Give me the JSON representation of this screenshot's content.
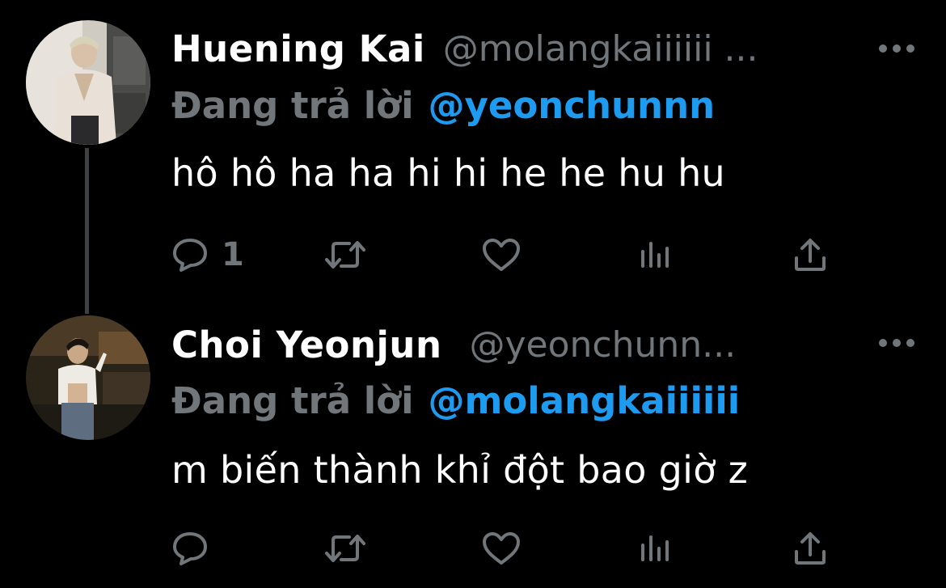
{
  "colors": {
    "background": "#000000",
    "name_text": "#ffffff",
    "secondary_text": "#71767b",
    "link": "#1d9bf0",
    "thread_line": "#3e4144"
  },
  "tweets": [
    {
      "display_name": "Huening Kai",
      "handle": "@molangkaiiiiii ...",
      "reply_prefix": "Đang trả lời",
      "reply_to": "@yeonchunnn",
      "text": "hô hô ha ha hi hi he he hu hu",
      "reply_count": "1",
      "icons": [
        "more-icon",
        "reply-icon",
        "retweet-icon",
        "like-icon",
        "views-icon",
        "share-icon"
      ]
    },
    {
      "display_name": "Choi Yeonjun",
      "handle": "@yeonchunn...",
      "reply_prefix": "Đang trả lời",
      "reply_to": "@molangkaiiiiii",
      "text": "m biến thành khỉ đột bao giờ z",
      "reply_count": "",
      "icons": [
        "more-icon",
        "reply-icon",
        "retweet-icon",
        "like-icon",
        "views-icon",
        "share-icon"
      ]
    }
  ]
}
